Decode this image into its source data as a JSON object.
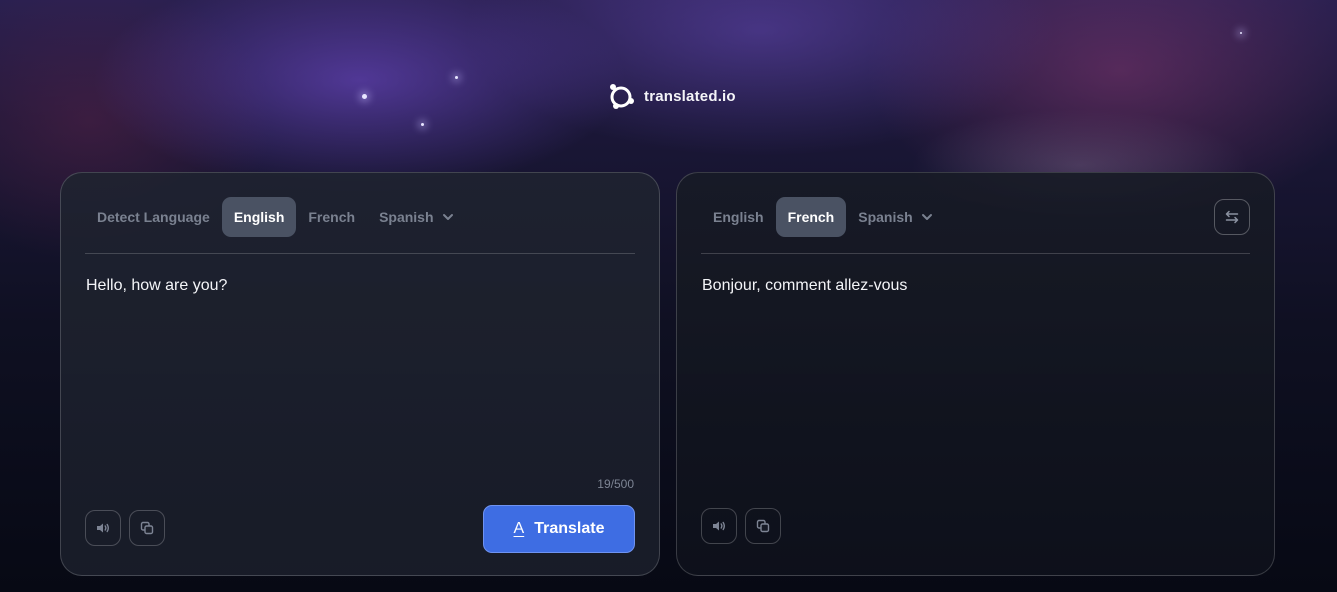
{
  "brand": {
    "name": "translated.io"
  },
  "source": {
    "tabs": [
      {
        "label": "Detect Language",
        "active": false
      },
      {
        "label": "English",
        "active": true
      },
      {
        "label": "French",
        "active": false
      },
      {
        "label": "Spanish",
        "active": false
      }
    ],
    "text": "Hello, how are you?",
    "counter": "19/500",
    "translate_label": "Translate",
    "translate_icon": "A"
  },
  "target": {
    "tabs": [
      {
        "label": "English",
        "active": false
      },
      {
        "label": "French",
        "active": true
      },
      {
        "label": "Spanish",
        "active": false
      }
    ],
    "text": "Bonjour, comment allez-vous"
  },
  "colors": {
    "accent": "#3e6de3",
    "tab_active_bg": "#4a5263"
  },
  "icons": {
    "speaker": "speaker-icon",
    "copy": "copy-icon",
    "swap": "swap-icon",
    "chevron": "chevron-down-icon",
    "logo": "logo-icon"
  }
}
